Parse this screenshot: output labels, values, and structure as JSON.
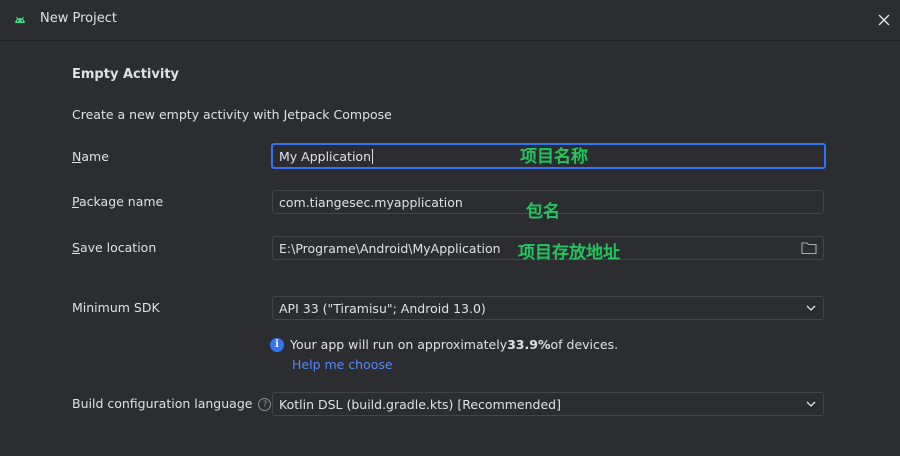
{
  "window": {
    "title": "New Project"
  },
  "section": {
    "title": "Empty Activity",
    "description": "Create a new empty activity with Jetpack Compose"
  },
  "fields": {
    "name": {
      "mnemonic": "N",
      "label_rest": "ame",
      "value": "My Application",
      "annotation": "项目名称"
    },
    "package": {
      "mnemonic": "P",
      "label_rest": "ackage name",
      "value": "com.tiangesec.myapplication",
      "annotation": "包名"
    },
    "location": {
      "mnemonic": "S",
      "label_rest": "ave location",
      "value": "E:\\Programe\\Android\\MyApplication",
      "annotation": "项目存放地址"
    },
    "min_sdk": {
      "label": "Minimum SDK",
      "value": "API 33 (\"Tiramisu\"; Android 13.0)"
    },
    "build_lang": {
      "label": "Build configuration language",
      "value": "Kotlin DSL (build.gradle.kts) [Recommended]"
    }
  },
  "info": {
    "prefix": "Your app will run on approximately ",
    "percent": "33.9%",
    "suffix": " of devices.",
    "link": "Help me choose"
  },
  "icons": {
    "app": "android-icon",
    "close": "close-icon",
    "folder": "folder-icon",
    "dropdown": "chevron-down-icon",
    "info": "info-icon",
    "help": "question-mark-icon"
  },
  "colors": {
    "accent": "#3574f0",
    "link": "#548af7",
    "annotation": "#22c55e",
    "background": "#2b2d30"
  }
}
